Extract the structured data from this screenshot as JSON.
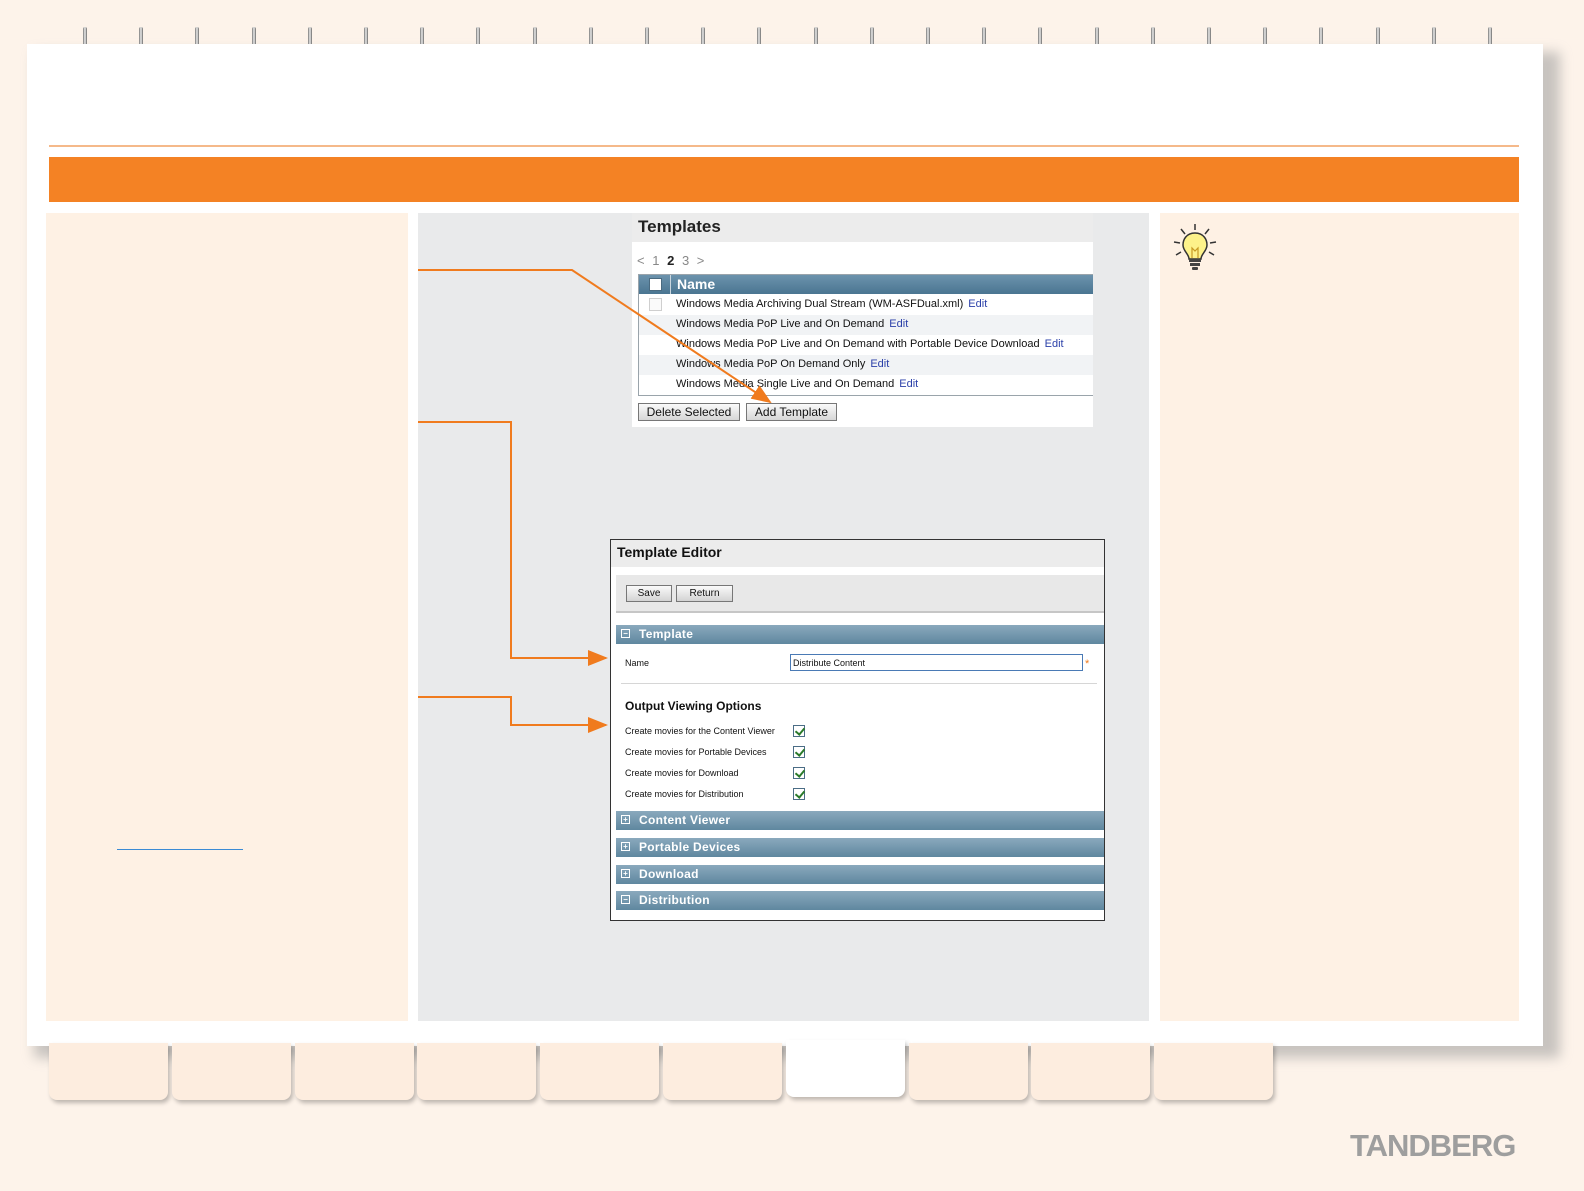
{
  "brand": {
    "logo_text": "TANDBERG",
    "accent_color": "#f48224"
  },
  "tabs": {
    "count": 10,
    "active_index": 6
  },
  "templates_panel": {
    "title": "Templates",
    "pager": {
      "prev": "<",
      "pages": [
        "1",
        "2",
        "3"
      ],
      "current": "2",
      "next": ">"
    },
    "column_header": "Name",
    "rows": [
      {
        "name": "Windows Media Archiving Dual Stream (WM-ASFDual.xml)",
        "action": "Edit"
      },
      {
        "name": "Windows Media PoP Live and On Demand",
        "action": "Edit"
      },
      {
        "name": "Windows Media PoP Live and On Demand with Portable Device Download",
        "action": "Edit"
      },
      {
        "name": "Windows Media PoP On Demand Only",
        "action": "Edit"
      },
      {
        "name": "Windows Media Single Live and On Demand",
        "action": "Edit"
      }
    ],
    "buttons": {
      "delete": "Delete Selected",
      "add": "Add Template"
    }
  },
  "template_editor": {
    "title": "Template Editor",
    "buttons": {
      "save": "Save",
      "return": "Return"
    },
    "sections": {
      "template": "Template",
      "content_viewer": "Content Viewer",
      "portable_devices": "Portable Devices",
      "download": "Download",
      "distribution": "Distribution"
    },
    "name_label": "Name",
    "name_value": "Distribute Content",
    "required_mark": "*",
    "output_heading": "Output Viewing Options",
    "options": [
      {
        "label": "Create movies for the Content Viewer",
        "checked": true
      },
      {
        "label": "Create movies for Portable Devices",
        "checked": true
      },
      {
        "label": "Create movies for Download",
        "checked": true
      },
      {
        "label": "Create movies for Distribution",
        "checked": true
      }
    ]
  },
  "icons": {
    "tip": "lightbulb-icon"
  }
}
